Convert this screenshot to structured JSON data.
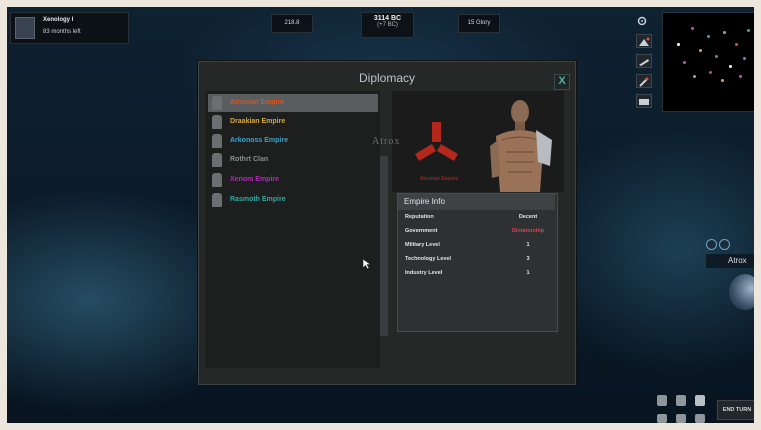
{
  "hud": {
    "player_name": "Xenology I",
    "player_status": "83 months left",
    "left_stat": "218.8",
    "year": "3114 BC",
    "year_delta": "(+7 BC)",
    "glory": "15 Glory"
  },
  "window": {
    "title": "Diplomacy",
    "close_label": "X"
  },
  "empires": [
    {
      "name": "Atroxian Empire",
      "color": "#d9541e",
      "selected": true
    },
    {
      "name": "Draakian Empire",
      "color": "#d8a93a",
      "selected": false
    },
    {
      "name": "Arkonoss Empire",
      "color": "#3fa1c9",
      "selected": false
    },
    {
      "name": "Rothrt Clan",
      "color": "#8b8f92",
      "selected": false
    },
    {
      "name": "Xenom Empire",
      "color": "#b32ab9",
      "selected": false
    },
    {
      "name": "Rasmoth Empire",
      "color": "#2ea8a0",
      "selected": false
    }
  ],
  "detail": {
    "watermark": "Atrox",
    "emblem_caption": "Atroxian Empire",
    "emblem_color": "#b3281a"
  },
  "empire_info": {
    "title": "Empire Info",
    "rows": [
      {
        "label": "Reputation",
        "value": "Decent",
        "color": "#e4e4e4"
      },
      {
        "label": "Government",
        "value": "Dictatorship",
        "color": "#d8405a"
      },
      {
        "label": "Military Level",
        "value": "1",
        "color": "#e4e4e4"
      },
      {
        "label": "Technology Level",
        "value": "3",
        "color": "#e4e4e4"
      },
      {
        "label": "Industry Level",
        "value": "1",
        "color": "#e4e4e4"
      }
    ]
  },
  "map_label": "Atrox",
  "end_turn": "END TURN",
  "icons": {
    "tools": [
      "settings-icon",
      "planet-icon",
      "ship-icon",
      "research-icon",
      "card-icon"
    ]
  }
}
